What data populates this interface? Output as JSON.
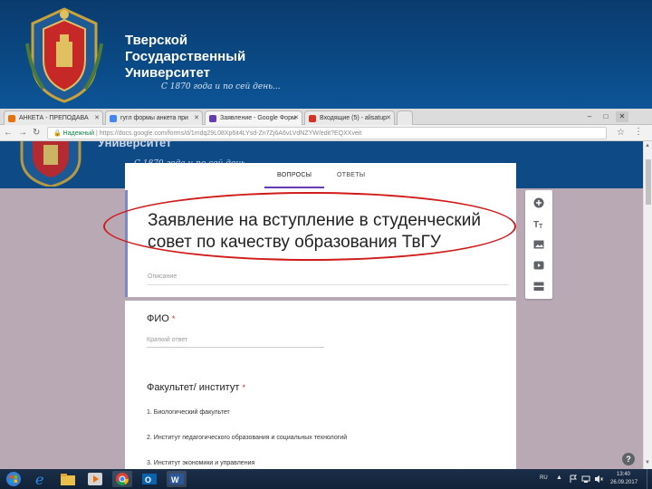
{
  "banner": {
    "name_line1": "Тверской",
    "name_line2": "Государственный",
    "name_line3": "Университет",
    "motto": "С 1870 года и по сей день..."
  },
  "tabs": [
    {
      "label": "АНКЕТА - ПРЕПОДАВА",
      "active": false,
      "fav_color": "#e8710a"
    },
    {
      "label": "гугл формы анкета при",
      "active": false,
      "fav_color": "#4285f4"
    },
    {
      "label": "Заявление - Google Форм",
      "active": true,
      "fav_color": "#673ab7"
    },
    {
      "label": "Входящие (5) - alisatup",
      "active": false,
      "fav_color": "#d93025"
    }
  ],
  "addressbar": {
    "secure_label": "Надежный",
    "url": "https://docs.google.com/forms/d/1mdq29L08Xp6it4LYsd-Zn7Zj6A6vLVdNZYW/edit?EQXXveit"
  },
  "page_header": {
    "ghost_name": "Университет",
    "ghost_motto": "С 1870 года и по сей день..."
  },
  "form_tabs": {
    "questions": "ВОПРОСЫ",
    "answers": "ОТВЕТЫ"
  },
  "form": {
    "title": "Заявление на вступление в студенческий совет по качеству образования ТвГУ",
    "description_placeholder": "Описание"
  },
  "questions": [
    {
      "title": "ФИО",
      "required_mark": "*",
      "hint": "Краткий ответ"
    },
    {
      "title": "Факультет/ институт",
      "required_mark": "*",
      "options": [
        "1.  Биологический факультет",
        "2.  Институт педагогического образования и социальных технологий",
        "3.  Институт экономики и управления"
      ]
    }
  ],
  "side_tools": [
    "add-question-icon",
    "add-title-icon",
    "add-image-icon",
    "add-video-icon",
    "add-section-icon"
  ],
  "help_label": "?",
  "tray": {
    "lang": "RU",
    "time": "13:40",
    "date": "26.09.2017"
  },
  "colors": {
    "accent": "#673ab7",
    "annotation": "#d11a1a",
    "banner": "#0b3b6e"
  }
}
